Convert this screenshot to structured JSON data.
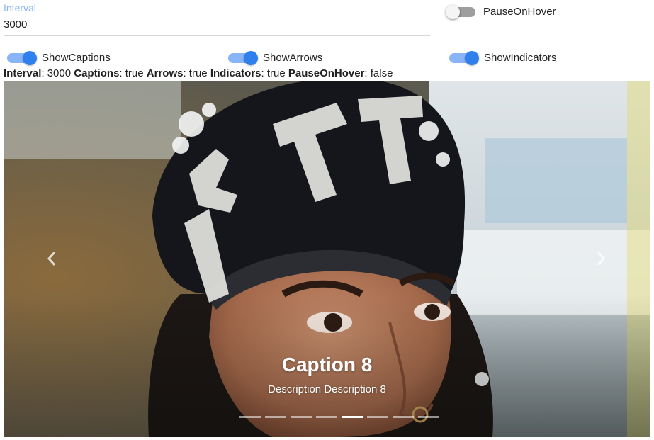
{
  "interval_field": {
    "label": "Interval",
    "value": "3000"
  },
  "toggles": {
    "pause_on_hover": {
      "label": "PauseOnHover",
      "checked": false
    },
    "show_captions": {
      "label": "ShowCaptions",
      "checked": true
    },
    "show_arrows": {
      "label": "ShowArrows",
      "checked": true
    },
    "show_indicators": {
      "label": "ShowIndicators",
      "checked": true
    }
  },
  "status": {
    "interval_key": "Interval",
    "interval_val": ": 3000",
    "captions_key": "Captions",
    "captions_val": ": true",
    "arrows_key": "Arrows",
    "arrows_val": ": true",
    "indicators_key": "Indicators",
    "indicators_val": ": true",
    "pause_key": "PauseOnHover",
    "pause_val": ": false"
  },
  "carousel": {
    "caption_title": "Caption 8",
    "caption_description": "Description Description 8",
    "indicator_count": 8,
    "active_index": 4,
    "prev_icon": "chevron-left-icon",
    "next_icon": "chevron-right-icon"
  },
  "colors": {
    "accent": "#2f80ed",
    "accent_light": "#8ab4f8"
  }
}
